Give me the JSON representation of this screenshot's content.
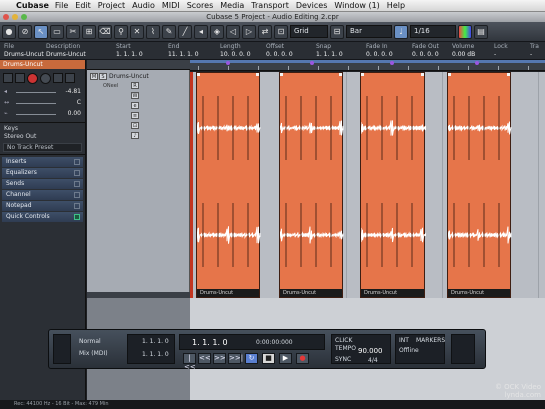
{
  "menubar": {
    "app": "Cubase",
    "items": [
      "File",
      "Edit",
      "Project",
      "Audio",
      "MIDI",
      "Scores",
      "Media",
      "Transport",
      "Devices",
      "Window (1)",
      "Help"
    ],
    "right": "⌘"
  },
  "window": {
    "title": "Cubase 5 Project - Audio Editing 2.cpr"
  },
  "toolbar": {
    "snap_value": "Bar",
    "quantize_value": "1/16",
    "grid_label": "Grid"
  },
  "infoline": {
    "columns": [
      {
        "label": "File",
        "value": "Drums-Uncut"
      },
      {
        "label": "Description",
        "value": "Drums-Uncut"
      },
      {
        "label": "Start",
        "value": "1. 1. 1. 0"
      },
      {
        "label": "End",
        "value": "11. 1. 1. 0"
      },
      {
        "label": "Length",
        "value": "10. 0. 0. 0"
      },
      {
        "label": "Offset",
        "value": "0. 0. 0. 0"
      },
      {
        "label": "Snap",
        "value": "1. 1. 1. 0"
      },
      {
        "label": "Fade In",
        "value": "0. 0. 0. 0"
      },
      {
        "label": "Fade Out",
        "value": "0. 0. 0. 0"
      },
      {
        "label": "Volume",
        "value": "0.00 dB"
      },
      {
        "label": "Lock",
        "value": "-"
      },
      {
        "label": "Tra",
        "value": "-"
      }
    ]
  },
  "inspector": {
    "track_name": "Drums-Uncut",
    "volume_value": "-4.81",
    "pan_value": "C",
    "delay_value": "0.00",
    "input": "Keys",
    "output": "Stereo Out",
    "track_preset": "No Track Preset",
    "sections": [
      "Inserts",
      "Equalizers",
      "Sends",
      "Channel",
      "Notepad",
      "Quick Controls"
    ]
  },
  "tracklist": {
    "track_name": "Drums-Uncut",
    "track_sub": "ONeel",
    "buttons": [
      "M",
      "S",
      "R",
      "W",
      "e"
    ]
  },
  "events": [
    {
      "label": "Drums-Uncut"
    },
    {
      "label": "Drums-Uncut"
    },
    {
      "label": "Drums-Uncut"
    },
    {
      "label": "Drums-Uncut"
    }
  ],
  "transport": {
    "mode_label": "Normal",
    "mix_label": "Mix (MDI)",
    "left_locator": "1. 1. 1. 0",
    "right_locator": "1. 1. 1. 0",
    "position": "1. 1. 1. 0",
    "time": "0:00:00:000",
    "tempo": "90.000",
    "signature": "4/4",
    "click_label": "CLICK",
    "sync_label": "SYNC",
    "int_label": "INT",
    "offline_label": "Offline",
    "tempo_label": "TEMPO",
    "track_label": "TRACK",
    "markers_label": "MARKERS",
    "buttons": [
      "|<<",
      "<<",
      ">>",
      ">>|",
      "↻",
      "■",
      "▶",
      "●"
    ]
  },
  "statusbar": "Rec: 44100 Hz - 16 Bit - Max: 479 Min",
  "watermark": {
    "line1": "© OCK Video",
    "line2": "lynda.com"
  }
}
